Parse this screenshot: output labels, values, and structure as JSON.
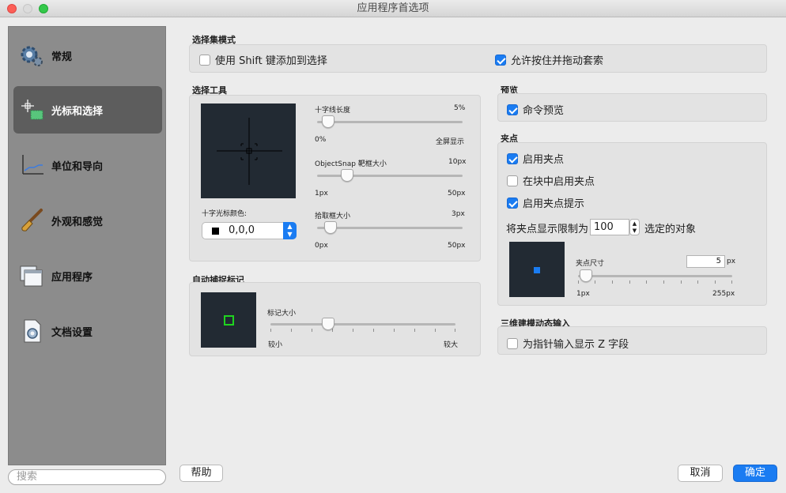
{
  "window": {
    "title": "应用程序首选项"
  },
  "sidebar": {
    "items": [
      {
        "label": "常规"
      },
      {
        "label": "光标和选择"
      },
      {
        "label": "单位和导向"
      },
      {
        "label": "外观和感觉"
      },
      {
        "label": "应用程序"
      },
      {
        "label": "文档设置"
      }
    ],
    "selected": "光标和选择",
    "search_placeholder": "搜索"
  },
  "selection_mode": {
    "title": "选择集模式",
    "use_shift": {
      "label": "使用 Shift 键添加到选择",
      "checked": false
    },
    "press_drag_lasso": {
      "label": "允许按住并拖动套索",
      "checked": true
    }
  },
  "selection_tool": {
    "title": "选择工具",
    "crosshair_color_label": "十字光标颜色:",
    "crosshair_color_value": "0,0,0",
    "crosshair_length": {
      "label": "十字线长度",
      "value": "5%",
      "min": "0%",
      "max": "全屏显示",
      "fraction": 0.05
    },
    "objectsnap_box": {
      "label": "ObjectSnap 靶框大小",
      "value": "10px",
      "min": "1px",
      "max": "50px",
      "fraction": 0.18
    },
    "pickbox": {
      "label": "拾取框大小",
      "value": "3px",
      "min": "0px",
      "max": "50px",
      "fraction": 0.06
    }
  },
  "autosnap_marker": {
    "title": "自动捕捉标记",
    "marker_size": {
      "label": "标记大小",
      "min": "较小",
      "max": "较大",
      "fraction": 0.32
    }
  },
  "preview": {
    "title": "预览",
    "command_preview": {
      "label": "命令预览",
      "checked": true
    }
  },
  "grips": {
    "title": "夹点",
    "enable_grips": {
      "label": "启用夹点",
      "checked": true
    },
    "grips_in_blocks": {
      "label": "在块中启用夹点",
      "checked": false
    },
    "grip_tips": {
      "label": "启用夹点提示",
      "checked": true
    },
    "limit_label": "将夹点显示限制为",
    "limit_value": "100",
    "limit_suffix": "选定的对象",
    "grip_size": {
      "label": "夹点尺寸",
      "value": "5",
      "unit": "px",
      "min": "1px",
      "max": "255px",
      "fraction": 0.0
    }
  },
  "dynamic_input": {
    "title": "三维建模动态输入",
    "show_z": {
      "label": "为指针输入显示 Z 字段",
      "checked": false
    }
  },
  "buttons": {
    "help": "帮助",
    "cancel": "取消",
    "ok": "确定"
  },
  "colors": {
    "accent": "#1a7cf2",
    "grip_square": "#1a7cf2",
    "marker": "#1fd41f",
    "preview_bg": "#222a33"
  }
}
